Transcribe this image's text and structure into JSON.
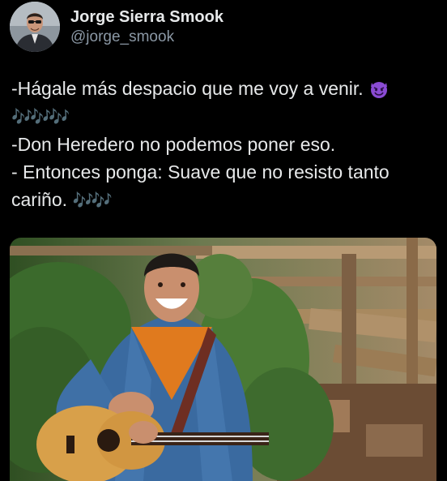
{
  "author": {
    "display_name": "Jorge Sierra Smook",
    "handle": "@jorge_smook",
    "avatar_icon": "profile-photo"
  },
  "tweet": {
    "lines": [
      "-Hágale más despacio que me voy a venir.",
      "-Don Heredero no podemos poner eso.",
      "- Entonces ponga: Suave que no resisto tanto",
      "cariño."
    ],
    "emoji_devil_icon": "smiling-devil-emoji",
    "notes_glyphs": "🎶🎶🎶",
    "notes_glyphs_short": "🎶🎶"
  },
  "media": {
    "icon": "photo-man-with-guitar",
    "colors": {
      "shirt": "#3a6aa0",
      "tshirt": "#e07a1e",
      "guitar": "#d8a04a",
      "foliage": "#3e6b2e",
      "wood": "#8a6a48"
    }
  },
  "colors": {
    "background": "#000000",
    "text": "#e7e9ea",
    "secondary_text": "#8b98a5",
    "devil_emoji": "#8a4bd3"
  }
}
